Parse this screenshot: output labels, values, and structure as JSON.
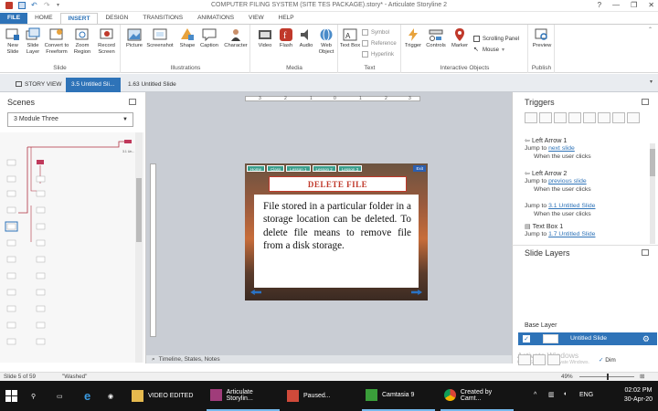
{
  "window": {
    "title": "COMPUTER FILING SYSTEM (SITE TES PACKAGE).story* - Articulate Storyline 2",
    "help": "?"
  },
  "ribbon_tabs": [
    "FILE",
    "HOME",
    "INSERT",
    "DESIGN",
    "TRANSITIONS",
    "ANIMATIONS",
    "VIEW",
    "HELP"
  ],
  "ribbon": {
    "slide": {
      "label": "Slide",
      "buttons": [
        "New Slide",
        "Slide Layer",
        "Convert to Freeform",
        "Zoom Region",
        "Record Screen"
      ]
    },
    "illustrations": {
      "label": "Illustrations",
      "buttons": [
        "Picture",
        "Screenshot",
        "Shape",
        "Caption",
        "Character"
      ]
    },
    "media": {
      "label": "Media",
      "buttons": [
        "Video",
        "Flash",
        "Audio",
        "Web Object"
      ]
    },
    "text": {
      "label": "Text",
      "buttons": [
        "Text Box"
      ],
      "small": [
        "Symbol",
        "Reference",
        "Hyperlink"
      ]
    },
    "interactive": {
      "label": "Interactive Objects",
      "buttons": [
        "Trigger",
        "Controls",
        "Marker"
      ],
      "small": [
        "Scrolling Panel",
        "Mouse"
      ]
    },
    "publish": {
      "label": "Publish",
      "buttons": [
        "Preview"
      ]
    }
  },
  "doc_tabs": [
    "STORY VIEW",
    "3.5 Untitled Sli...",
    "1.63 Untitled Slide"
  ],
  "scenes": {
    "title": "Scenes",
    "dropdown": "3 Module Three",
    "label_top": "3.1 Un..."
  },
  "slide": {
    "nav": [
      "Home",
      "Class",
      "Lesson 1",
      "Lesson 2",
      "Lesson 3"
    ],
    "exit": "Exit",
    "title": "DELETE FILE",
    "body": "File stored in a particular folder in a storage location can be deleted. To delete file means to remove file from a disk storage."
  },
  "ruler": {
    "marks": [
      "3",
      "2",
      "1",
      "0",
      "1",
      "2",
      "3"
    ]
  },
  "timeline_label": "Timeline, States, Notes",
  "triggers": {
    "title": "Triggers",
    "items": [
      {
        "name": "Left Arrow 1",
        "action": "Jump to",
        "target": "next slide",
        "when": "When the user clicks"
      },
      {
        "name": "Left Arrow 2",
        "action": "Jump to",
        "target": "previous slide",
        "when": "When the user clicks"
      },
      {
        "name": null,
        "action": "Jump to",
        "target": "3.1 Untitled Slide",
        "when": "When the user clicks"
      },
      {
        "name": "Text Box 1",
        "action": "Jump to",
        "target": "1.7 Untitled Slide",
        "when": null
      }
    ]
  },
  "layers": {
    "title": "Slide Layers",
    "base_label": "Base Layer",
    "layer_name": "Untitled Slide",
    "watermark": "Activate Windows",
    "watermark_sub": "Go to Settings to activate Windows.",
    "dim": "Dim"
  },
  "status": {
    "left": "Slide 5 of 59",
    "theme": "\"Washed\"",
    "zoom": "49%"
  },
  "taskbar": {
    "apps": [
      "VIDEO EDITED",
      "Articulate Storylin...",
      "Paused...",
      "Camtasia 9",
      "Created by Camt..."
    ],
    "lang": "ENG",
    "time": "02:02 PM",
    "date": "30-Apr-20"
  },
  "colors": {
    "accent": "#2e73b8",
    "slide_title": "#c0392b",
    "nav_green": "#3c9e8c"
  }
}
